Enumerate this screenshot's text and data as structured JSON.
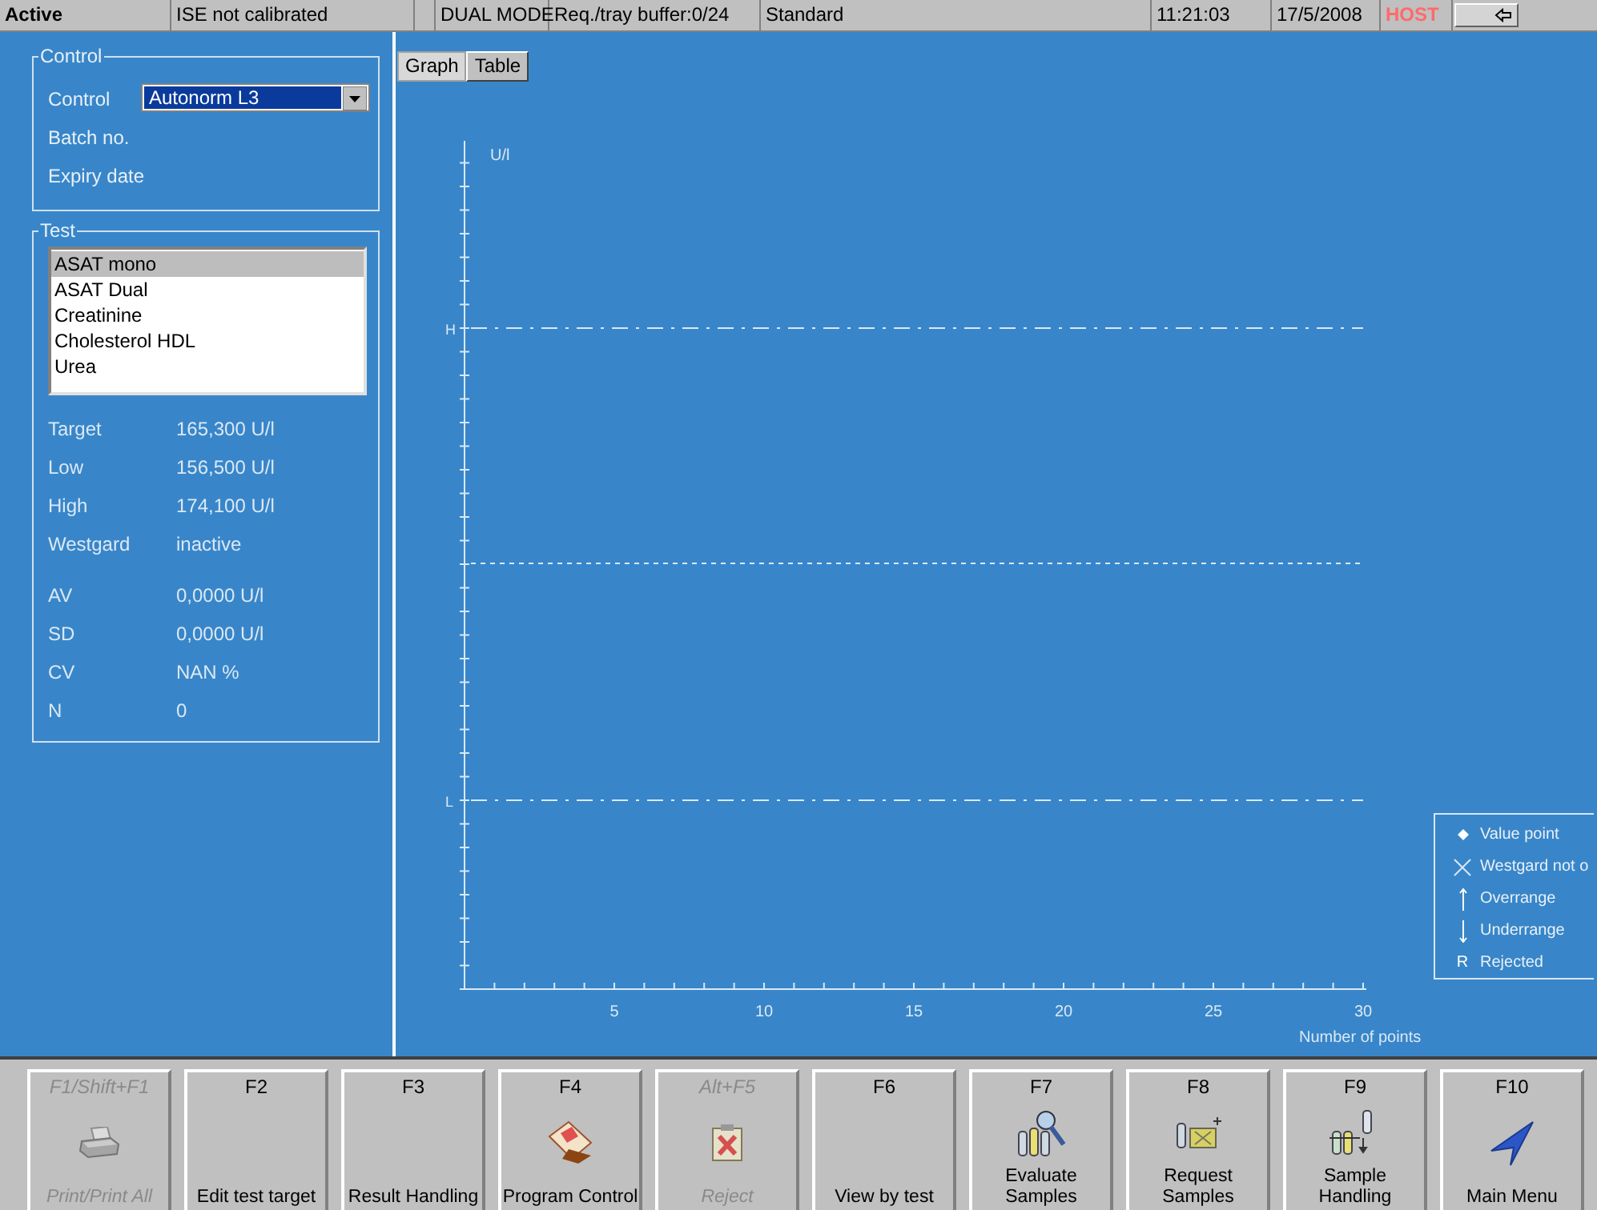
{
  "status_bar": [
    {
      "text": "Active",
      "kind": "bold"
    },
    {
      "text": "ISE not calibrated",
      "kind": "plain"
    },
    {
      "text": "DUAL MODE",
      "kind": "plain"
    },
    {
      "text": "Req./tray buffer:0/24",
      "kind": "plain"
    },
    {
      "text": "Standard",
      "kind": "wide"
    },
    {
      "text": "11:21:03",
      "kind": "plain"
    },
    {
      "text": "17/5/2008",
      "kind": "plain"
    },
    {
      "text": "HOST",
      "kind": "alert"
    }
  ],
  "control_group": {
    "title": "Control",
    "control_label": "Control",
    "control_value": "Autonorm L3",
    "fields": [
      "Batch no.",
      "Expiry date"
    ]
  },
  "test_group": {
    "title": "Test",
    "tests": [
      {
        "label": "ASAT mono",
        "selected": true
      },
      {
        "label": "ASAT Dual",
        "selected": false
      },
      {
        "label": "Creatinine",
        "selected": false
      },
      {
        "label": "Cholesterol HDL",
        "selected": false
      },
      {
        "label": "Urea",
        "selected": false
      }
    ],
    "values": [
      {
        "label": "Target",
        "value": "165,300 U/l"
      },
      {
        "label": "Low",
        "value": "156,500 U/l"
      },
      {
        "label": "High",
        "value": "174,100 U/l"
      },
      {
        "label": "Westgard",
        "value": "inactive"
      },
      {
        "label": "AV",
        "value": "0,0000 U/l"
      },
      {
        "label": "SD",
        "value": "0,0000 U/l"
      },
      {
        "label": "CV",
        "value": "NAN %"
      },
      {
        "label": "N",
        "value": "0"
      }
    ]
  },
  "tabs": [
    {
      "label": "Graph",
      "selected": true
    },
    {
      "label": "Table",
      "selected": false
    }
  ],
  "chart": {
    "y_axis_title": "U/l",
    "x_axis_title": "Number of points",
    "x_tick_labels": [
      "5",
      "10",
      "15",
      "20",
      "25",
      "30"
    ],
    "limit_labels": [
      "H",
      "L"
    ],
    "legend": [
      {
        "kind": "dot",
        "label": "Value point"
      },
      {
        "kind": "cross",
        "label": "Westgard not o"
      },
      {
        "kind": "up",
        "label": "Overrange"
      },
      {
        "kind": "down",
        "label": "Underrange"
      },
      {
        "kind": "letter",
        "symbol": "R",
        "label": "Rejected"
      }
    ]
  },
  "function_keys": [
    {
      "key": "F1/Shift+F1",
      "label": "Print/Print All",
      "kind": "printer",
      "disabled": true
    },
    {
      "key": "F2",
      "label": "Edit test target",
      "kind": "plain",
      "disabled": false
    },
    {
      "key": "F3",
      "label": "Result Handling",
      "kind": "plain",
      "disabled": false
    },
    {
      "key": "F4",
      "label": "Program Control",
      "kind": "document",
      "disabled": false
    },
    {
      "key": "Alt+F5",
      "label": "Reject",
      "kind": "reject",
      "disabled": true
    },
    {
      "key": "F6",
      "label": "View by test",
      "kind": "plain",
      "disabled": false
    },
    {
      "key": "F7",
      "label": "Evaluate Samples",
      "kind": "evaluate",
      "disabled": false
    },
    {
      "key": "F8",
      "label": "Request Samples",
      "kind": "request",
      "disabled": false
    },
    {
      "key": "F9",
      "label": "Sample Handling",
      "kind": "handling",
      "disabled": false
    },
    {
      "key": "F10",
      "label": "Main Menu",
      "kind": "navigate",
      "disabled": false
    }
  ]
}
